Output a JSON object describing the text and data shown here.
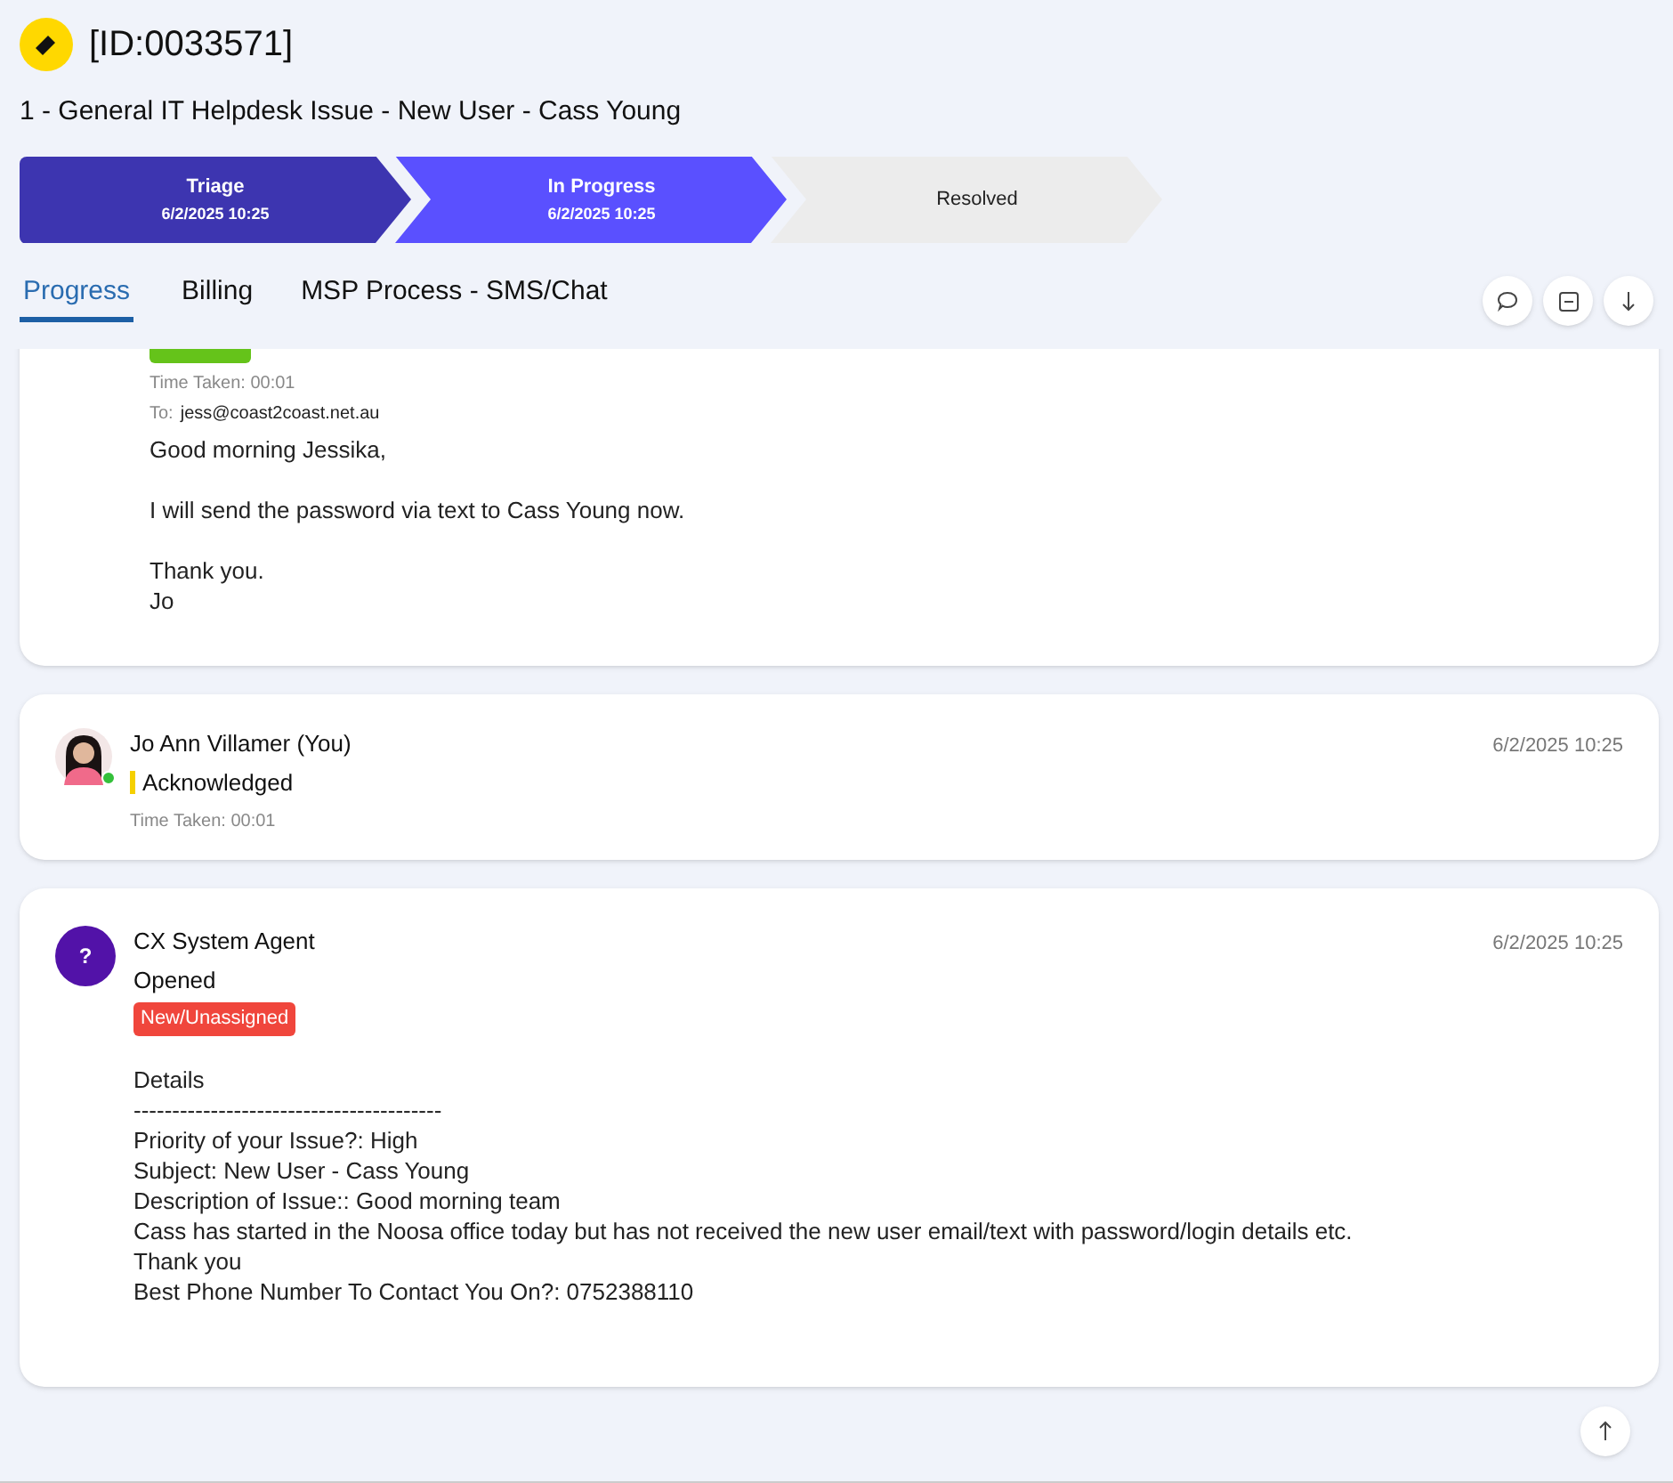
{
  "ticket": {
    "id": "[ID:0033571]",
    "title": "1 - General IT Helpdesk Issue - New User - Cass Young"
  },
  "stages": [
    {
      "label": "Triage",
      "time": "6/2/2025 10:25",
      "kind": "done"
    },
    {
      "label": "In Progress",
      "time": "6/2/2025 10:25",
      "kind": "current"
    },
    {
      "label": "Resolved",
      "kind": "pending"
    }
  ],
  "tabs": [
    {
      "label": "Progress",
      "selected": true
    },
    {
      "label": "Billing",
      "selected": false
    },
    {
      "label": "MSP Process - SMS/Chat",
      "selected": false
    }
  ],
  "entries": [
    {
      "kind": "email",
      "badge": {
        "color": "#65c31a"
      },
      "time_taken": "Time Taken: 00:01",
      "to_label": "To:",
      "to": "jess@coast2coast.net.au",
      "paragraphs": [
        [
          "Good morning Jessika,"
        ],
        [
          "I will send the password via text to Cass Young now."
        ],
        [
          "Thank you.",
          "Jo"
        ]
      ]
    },
    {
      "kind": "status",
      "author": "Jo Ann Villamer (You)",
      "avatar": {
        "kind": "photo",
        "online": true
      },
      "status": {
        "text": "Acknowledged",
        "color": "#f5d000"
      },
      "time_taken": "Time Taken: 00:01",
      "date": "6/2/2025 10:25"
    },
    {
      "kind": "opened",
      "author": "CX System Agent",
      "avatar": {
        "kind": "initial",
        "text": "?"
      },
      "status": {
        "text": "Opened"
      },
      "badge": {
        "text": "New/Unassigned",
        "color": "#f0463c"
      },
      "date": "6/2/2025 10:25",
      "paragraphs": [
        [
          "Details",
          "----------------------------------------",
          "Priority of your Issue?: High",
          "Subject: New User - Cass Young",
          "Description of Issue:: Good morning team",
          "Cass has started in the Noosa office today but has not received the new user email/text with password/login details etc.",
          "Thank you",
          "Best Phone Number To Contact You On?: 0752388110"
        ]
      ]
    }
  ]
}
